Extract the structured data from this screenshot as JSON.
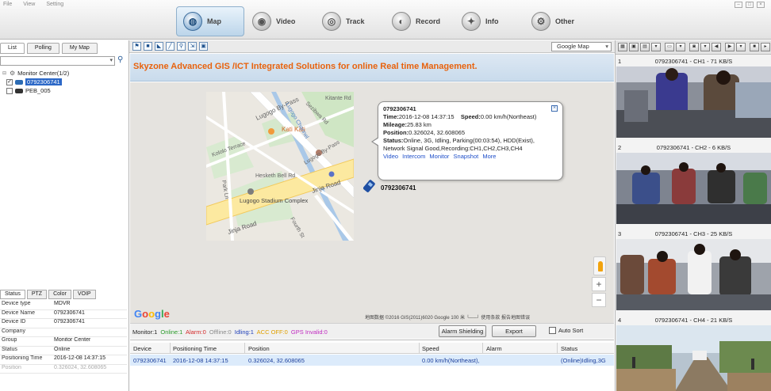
{
  "app_menu": [
    "File",
    "View",
    "Setting"
  ],
  "nav_tabs": [
    {
      "label": "Map",
      "icon": "globe-icon",
      "active": true
    },
    {
      "label": "Video",
      "icon": "camera-icon",
      "active": false
    },
    {
      "label": "Track",
      "icon": "track-icon",
      "active": false
    },
    {
      "label": "Record",
      "icon": "record-icon",
      "active": false
    },
    {
      "label": "Info",
      "icon": "info-icon",
      "active": false
    },
    {
      "label": "Other",
      "icon": "gear-icon",
      "active": false
    }
  ],
  "left_panel": {
    "tabs": [
      "List",
      "Polling",
      "My Map"
    ],
    "search_value": "",
    "tree": {
      "root": "Monitor Center(1/2)",
      "devices": [
        {
          "name": "0792306741",
          "checked": true,
          "online": true,
          "selected": true
        },
        {
          "name": "PEB_005",
          "checked": false,
          "online": false,
          "selected": false
        }
      ]
    },
    "detail_tabs": [
      "Status",
      "PTZ",
      "Color",
      "VOIP"
    ],
    "detail_rows": [
      {
        "key": "Device type",
        "value": "MDVR"
      },
      {
        "key": "Device Name",
        "value": "0792306741"
      },
      {
        "key": "Device ID",
        "value": "0792306741"
      },
      {
        "key": "Company",
        "value": ""
      },
      {
        "key": "Group",
        "value": "Monitor Center"
      },
      {
        "key": "Status",
        "value": "Online"
      },
      {
        "key": "Positioning Time",
        "value": "2016-12-08 14:37:15"
      },
      {
        "key": "Position",
        "value": "0.326024, 32.608065"
      }
    ]
  },
  "map": {
    "type_select": "Google Map",
    "banner": "Skyzone Advanced GIS /ICT Integrated Solutions for online Real time Management.",
    "copyright": "地图数据 ©2016 GIS(2011)6020 Google   100 米 └──┘   使用条款   报告地图错误",
    "labels": {
      "road1": "Lugogo By-Pass",
      "road2": "Hesketh Bell Rd",
      "road3": "Kololo Terrace",
      "road4": "Jinja Road",
      "road5": "Jinja Road",
      "place1": "Kati Kati",
      "place2": "Lugogo Stadium Complex",
      "road6": "Fourth St",
      "road7": "Park Ln",
      "road8": "Lugogo Channel",
      "road9": "Lugogo By-Pass",
      "road10": "Sezibwa Rd",
      "road11": "Kitante Rd"
    },
    "google_logo": [
      "G",
      "o",
      "o",
      "g",
      "l",
      "e"
    ],
    "zoom_in": "+",
    "zoom_out": "−",
    "vehicle_label": "0792306741",
    "popup": {
      "title": "0792306741",
      "time_label": "Time:",
      "time_value": "2016-12-08 14:37:15",
      "speed_label": "Speed:",
      "speed_value": "0.00 km/h(Northeast)",
      "mileage_label": "Mileage:",
      "mileage_value": "25.83 km",
      "position_label": "Position:",
      "position_value": "0.326024, 32.608065",
      "status_label": "Status:",
      "status_value": "Online, 3G, Idling, Parking(00:03:54), HDD(Exist), Network Signal Good,Recording:CH1,CH2,CH3,CH4",
      "links": [
        "Video",
        "Intercom",
        "Monitor",
        "Snapshot",
        "More"
      ]
    }
  },
  "status_strip": {
    "counts": [
      {
        "text": "Monitor:1",
        "color": "#222222"
      },
      {
        "text": "Online:1",
        "color": "#2a9a2a"
      },
      {
        "text": "Alarm:0",
        "color": "#d42a2a"
      },
      {
        "text": "Offline:0",
        "color": "#8a8a8a"
      },
      {
        "text": "Idling:1",
        "color": "#1f3fb8"
      },
      {
        "text": "ACC OFF:0",
        "color": "#e0a000"
      },
      {
        "text": "GPS Invalid:0",
        "color": "#c02ac0"
      }
    ],
    "alarm_shielding": "Alarm Shielding",
    "export": "Export",
    "auto_sort": "Auto Sort"
  },
  "device_table": {
    "headers": [
      "Device",
      "Positioning Time",
      "Position",
      "Speed",
      "Alarm",
      "Status"
    ],
    "rows": [
      [
        "0792306741",
        "2016-12-08 14:37:15",
        "0.326024, 32.608065",
        "0.00 km/h(Northeast),",
        "",
        "(Online)Idling,3G"
      ]
    ]
  },
  "video_panel": {
    "channels": [
      {
        "num": "1",
        "label": "0792306741 - CH1 - 71 KB/S"
      },
      {
        "num": "2",
        "label": "0792306741 - CH2 - 6 KB/S"
      },
      {
        "num": "3",
        "label": "0792306741 - CH3 - 25 KB/S"
      },
      {
        "num": "4",
        "label": "0792306741 - CH4 - 21 KB/S"
      }
    ]
  },
  "colors": {
    "banner_text": "#e8620d",
    "selection": "#2c68c7",
    "link": "#1d4ec9"
  }
}
